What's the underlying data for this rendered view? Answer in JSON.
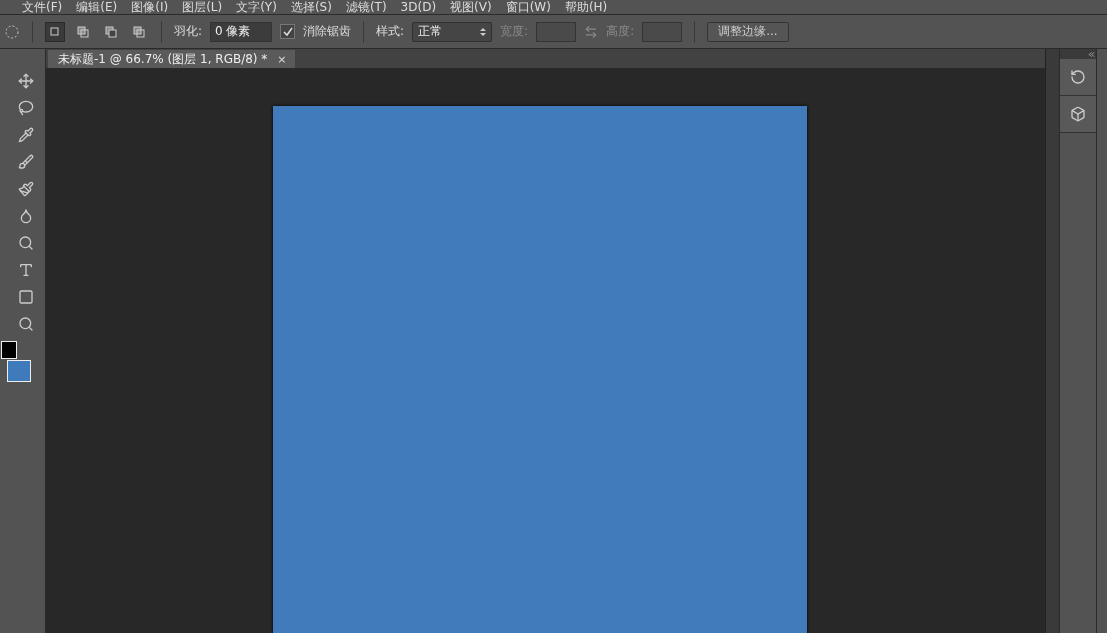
{
  "menu": [
    "文件(F)",
    "编辑(E)",
    "图像(I)",
    "图层(L)",
    "文字(Y)",
    "选择(S)",
    "滤镜(T)",
    "3D(D)",
    "视图(V)",
    "窗口(W)",
    "帮助(H)"
  ],
  "options": {
    "selection_modes": [
      {
        "selected": true
      },
      {
        "selected": false
      },
      {
        "selected": false
      },
      {
        "selected": false
      }
    ],
    "feather_label": "羽化:",
    "feather_value": "0 像素",
    "antialias_label": "消除锯齿",
    "antialias_checked": true,
    "style_label": "样式:",
    "style_value": "正常",
    "width_label": "宽度:",
    "height_label": "高度:",
    "refine_button": "调整边缘..."
  },
  "document_tab": {
    "title": "未标题-1 @ 66.7% (图层 1, RGB/8) *",
    "close": "×"
  },
  "tools": [
    {
      "kind": "move"
    },
    {
      "kind": "lasso"
    },
    {
      "kind": "eyedropper"
    },
    {
      "kind": "brush"
    },
    {
      "kind": "history-brush"
    },
    {
      "kind": "gradient"
    },
    {
      "kind": "dodge"
    },
    {
      "kind": "type"
    },
    {
      "kind": "rectangle"
    },
    {
      "kind": "zoom"
    }
  ],
  "swatches": [
    {
      "kind": "foreground",
      "color": "#000000"
    },
    {
      "kind": "background",
      "color": "#3f7abb"
    }
  ],
  "canvas": {
    "color": "#417bbb"
  },
  "dock": [
    {
      "kind": "history"
    },
    {
      "kind": "model"
    }
  ]
}
